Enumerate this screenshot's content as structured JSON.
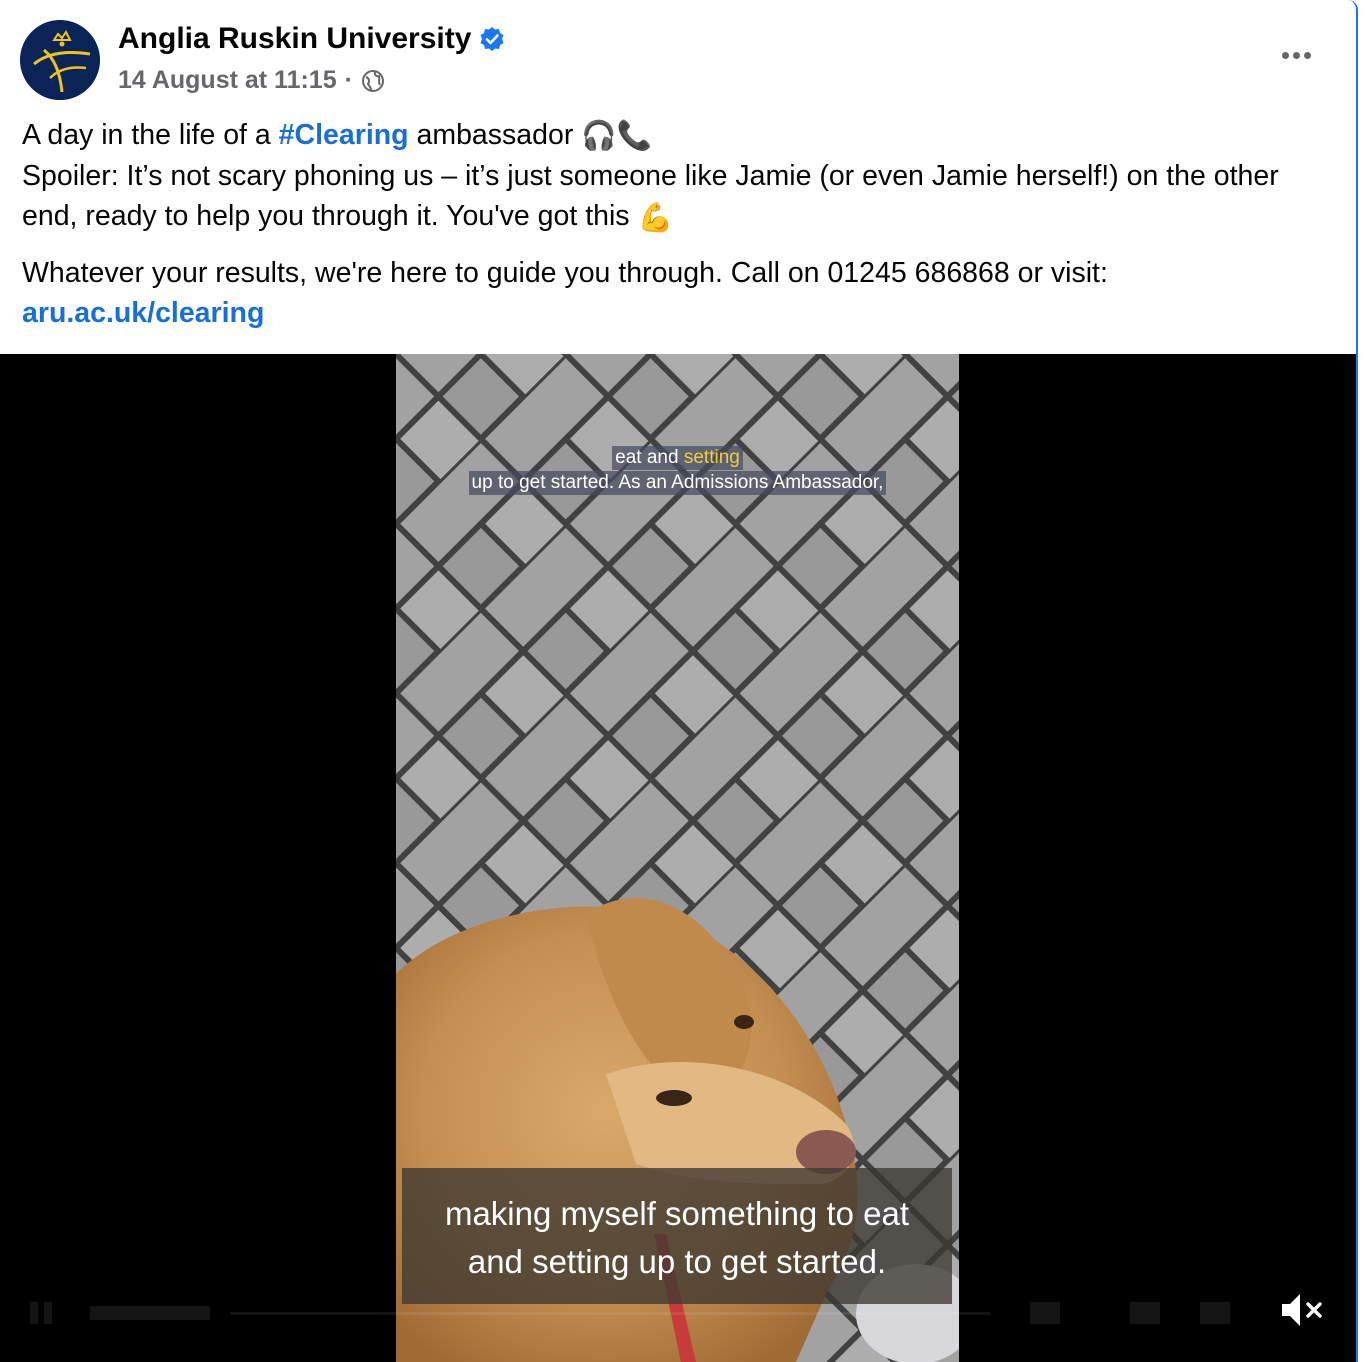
{
  "post": {
    "author": "Anglia Ruskin University",
    "timestamp": "14 August at 11:15",
    "separator": "·",
    "privacy_icon": "globe-icon",
    "verified_icon": "verified-badge-icon",
    "more_icon": "more-options-icon",
    "text": {
      "line1_before": "A day in the life of a ",
      "hashtag": "#Clearing",
      "line1_after": " ambassador ",
      "line1_emoji": "🎧📞",
      "line2": "Spoiler: It’s not scary phoning us – it’s just someone like Jamie (or even Jamie herself!) on the other end, ready to help you through it. You've got this ",
      "line2_emoji": "💪",
      "line3": "Whatever your results, we're here to guide you through. Call on 01245 686868 or visit: ",
      "link": "aru.ac.uk/clearing"
    }
  },
  "video": {
    "subtitle_top_line1_a": "eat and ",
    "subtitle_top_line1_b": "setting",
    "subtitle_top_line2": "up to get started. As an Admissions Ambassador,",
    "caption_line1": "making myself something to eat",
    "caption_line2": "and setting up to get started.",
    "mute_icon": "muted-speaker-icon"
  },
  "colors": {
    "link": "#1a6ed8",
    "brand_navy": "#0b2458",
    "brand_gold": "#f2c418",
    "verified": "#1877f2",
    "meta": "#65676b"
  }
}
